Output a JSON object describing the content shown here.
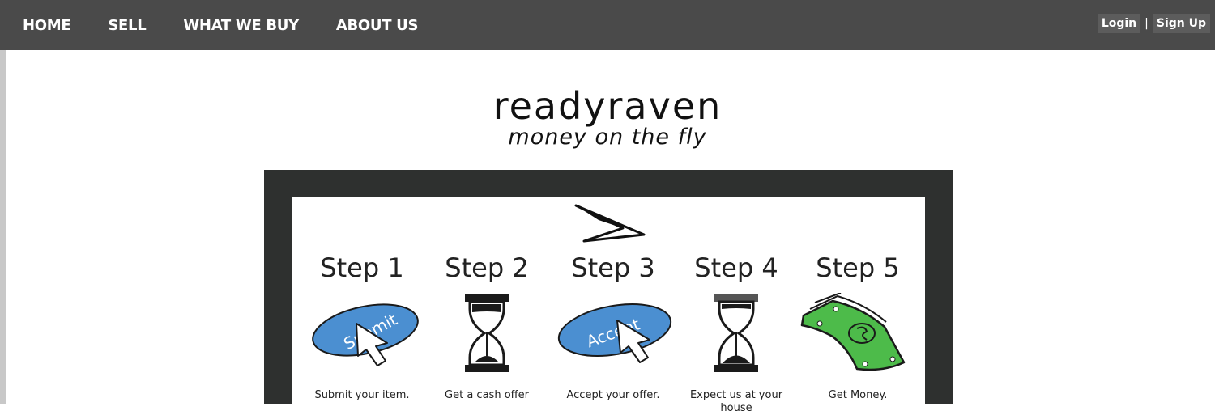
{
  "nav": {
    "links": [
      "HOME",
      "SELL",
      "WHAT WE BUY",
      "ABOUT US"
    ],
    "login": "Login",
    "separator": "|",
    "signup": "Sign Up"
  },
  "brand": {
    "name": "readyraven",
    "tagline": "money on the fly"
  },
  "steps": [
    {
      "title": "Step 1",
      "icon": "submit-button-cursor-icon",
      "icon_text": "Submit",
      "caption": "Submit your item."
    },
    {
      "title": "Step 2",
      "icon": "hourglass-icon",
      "caption": "Get a cash offer"
    },
    {
      "title": "Step 3",
      "icon": "accept-button-cursor-icon",
      "icon_text": "Accept",
      "caption": "Accept your offer."
    },
    {
      "title": "Step 4",
      "icon": "hourglass-icon",
      "caption": "Expect us at your house"
    },
    {
      "title": "Step 5",
      "icon": "money-icon",
      "caption": "Get Money."
    }
  ],
  "colors": {
    "nav_bg": "#4a4a4a",
    "panel_bg": "#2e302f",
    "button_blue": "#4b8fd1",
    "money_green": "#4dbb4a"
  }
}
